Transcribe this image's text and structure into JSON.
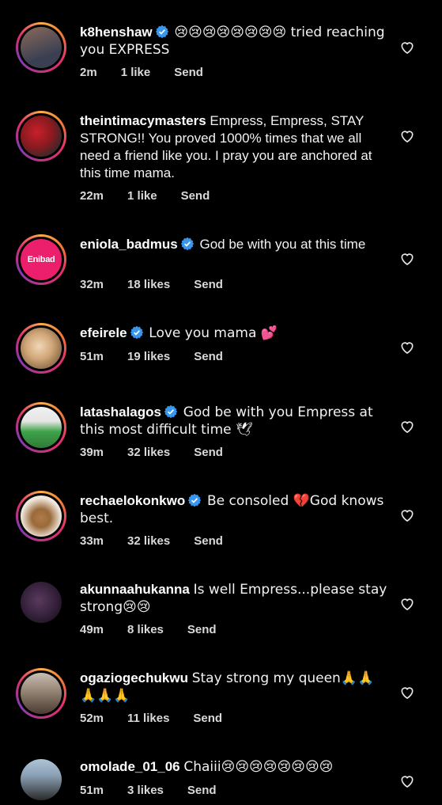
{
  "comments": [
    {
      "username": "k8henshaw",
      "verified": true,
      "text": "😢😢😢😢😢😢😢😢 tried reaching you EXPRESS",
      "time": "2m",
      "likes": "1 like",
      "reply": "Send",
      "avatar_colors": [
        "#3a3f52",
        "#8a6a5a"
      ],
      "story_ring": true
    },
    {
      "username": "theintimacymasters",
      "verified": false,
      "text": "Empress, Empress, STAY STRONG!! You  proved 1000% times that we all need a friend like you. I pray you are anchored at this time mama.",
      "time": "22m",
      "likes": "1 like",
      "reply": "Send",
      "avatar_colors": [
        "#c8202a",
        "#2b2b2b"
      ],
      "story_ring": true
    },
    {
      "username": "eniola_badmus",
      "verified": true,
      "text": "God be with you at this time",
      "time": "32m",
      "likes": "18 likes",
      "reply": "Send",
      "avatar_colors": [
        "#ec1f6c",
        "#ec1f6c"
      ],
      "avatar_text": "Enibad",
      "story_ring": true
    },
    {
      "username": "efeirele",
      "verified": true,
      "text": "Love you mama 💕",
      "time": "51m",
      "likes": "19 likes",
      "reply": "Send",
      "avatar_colors": [
        "#e6c8a0",
        "#a9805a"
      ],
      "story_ring": true
    },
    {
      "username": "latashalagos",
      "verified": true,
      "text": "God be with you Empress  at this most difficult time 🕊",
      "time": "39m",
      "likes": "32 likes",
      "reply": "Send",
      "avatar_colors": [
        "#f0f0f0",
        "#3ea34a"
      ],
      "story_ring": true
    },
    {
      "username": "rechaelokonkwo",
      "verified": true,
      "text": "Be consoled 💔God knows best.",
      "time": "33m",
      "likes": "32 likes",
      "reply": "Send",
      "avatar_colors": [
        "#efe6dc",
        "#9a6a3a"
      ],
      "story_ring": true
    },
    {
      "username": "akunnaahukanna",
      "verified": false,
      "text": "Is well Empress...please stay strong😢😢",
      "time": "49m",
      "likes": "8 likes",
      "reply": "Send",
      "avatar_colors": [
        "#2a1e2e",
        "#5a3a5e"
      ],
      "story_ring": false
    },
    {
      "username": "ogaziogechukwu",
      "verified": false,
      "text": "Stay strong my queen🙏🙏🙏🙏🙏",
      "time": "52m",
      "likes": "11 likes",
      "reply": "Send",
      "avatar_colors": [
        "#9a8a7a",
        "#4a3a30"
      ],
      "story_ring": true
    },
    {
      "username": "omolade_01_06",
      "verified": false,
      "text": "Chaiii😢😢😢😢😢😢😢😢",
      "time": "51m",
      "likes": "3 likes",
      "reply": "Send",
      "avatar_colors": [
        "#b0c4d8",
        "#2a2a2a"
      ],
      "story_ring": false
    }
  ],
  "icons": {
    "verified": "verified-badge-icon",
    "like": "heart-outline-icon"
  },
  "colors": {
    "background": "#000000",
    "verified": "#3897f0",
    "text": "#f5f5f5"
  }
}
